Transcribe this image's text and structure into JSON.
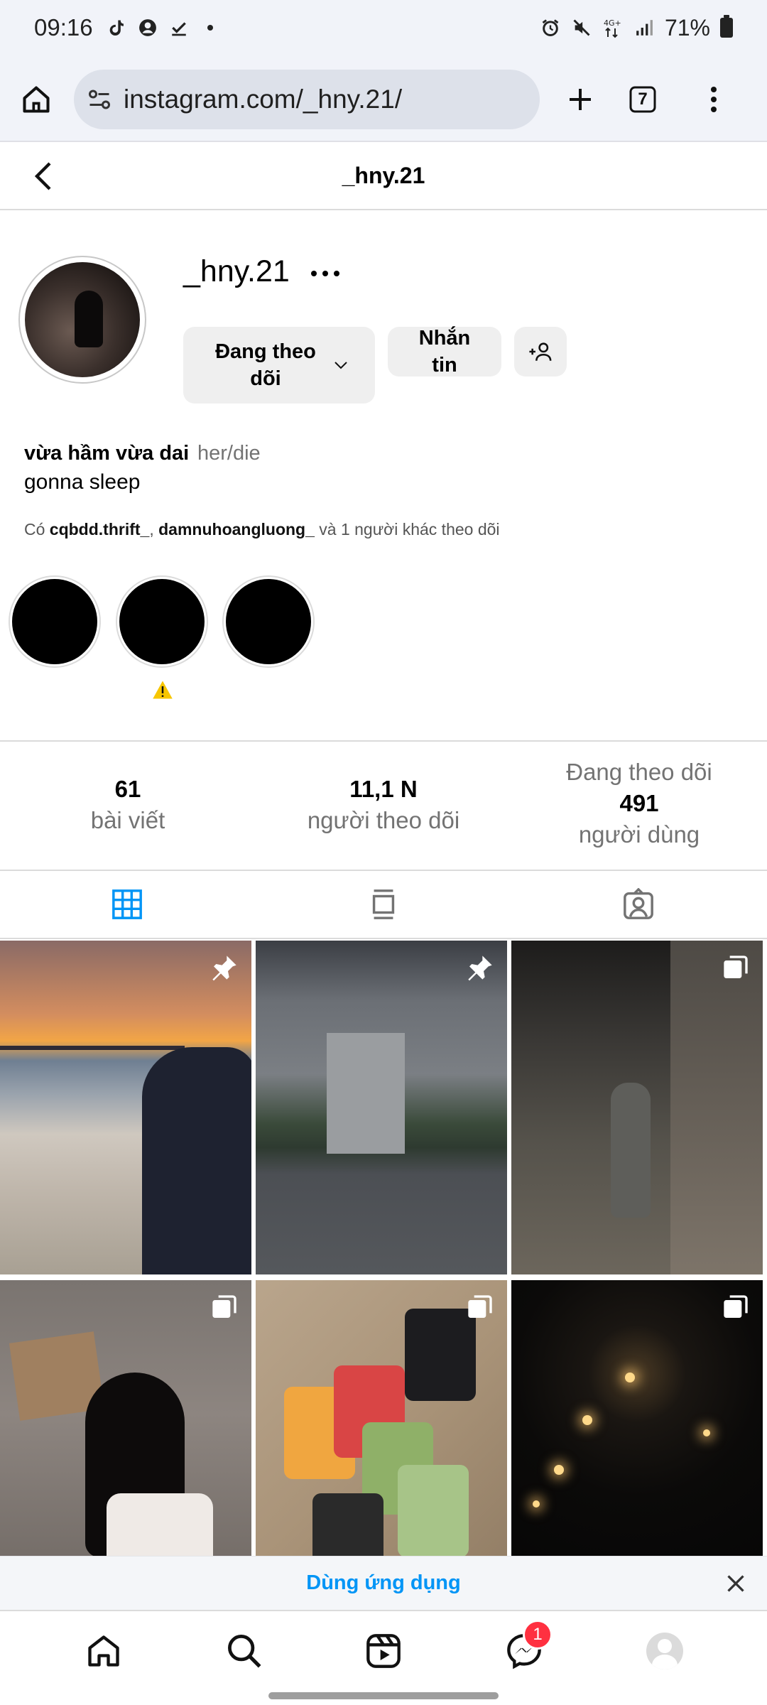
{
  "status_bar": {
    "time": "09:16",
    "battery": "71%"
  },
  "browser": {
    "url": "instagram.com/_hny.21/",
    "tab_count": "7"
  },
  "header": {
    "title": "_hny.21"
  },
  "profile": {
    "username": "_hny.21",
    "follow_button": "Đang theo dõi",
    "message_button": "Nhắn tin",
    "display_name": "vừa hầm vừa dai",
    "pronouns": "her/die",
    "bio": "gonna sleep",
    "followed_by_prefix": "Có",
    "followed_by_user1": "cqbdd.thrift_",
    "followed_by_sep": ",",
    "followed_by_user2": "damnuhoangluong_",
    "followed_by_suffix": "và 1 người khác theo dõi"
  },
  "highlights": [
    {
      "name": "highlight-1"
    },
    {
      "name": "highlight-2"
    },
    {
      "name": "highlight-3"
    }
  ],
  "stats": {
    "posts_count": "61",
    "posts_label": "bài viết",
    "followers_count": "11,1 N",
    "followers_label": "người theo dõi",
    "following_prefix": "Đang theo dõi",
    "following_count": "491",
    "following_label": "người dùng"
  },
  "tabs": [
    {
      "name": "posts-grid",
      "icon": "grid-icon",
      "active": true
    },
    {
      "name": "feed",
      "icon": "feed-icon",
      "active": false
    },
    {
      "name": "tagged",
      "icon": "tagged-icon",
      "active": false
    }
  ],
  "posts": [
    {
      "badge": "pin-icon"
    },
    {
      "badge": "pin-icon"
    },
    {
      "badge": "carousel-icon"
    },
    {
      "badge": "carousel-icon"
    },
    {
      "badge": "carousel-icon"
    },
    {
      "badge": "carousel-icon"
    }
  ],
  "app_banner": {
    "label": "Dùng ứng dụng"
  },
  "bottom_nav": {
    "messages_badge": "1"
  },
  "colors": {
    "accent": "#0095f6",
    "badge": "#ff3040",
    "active_tab": "#0095f6"
  }
}
